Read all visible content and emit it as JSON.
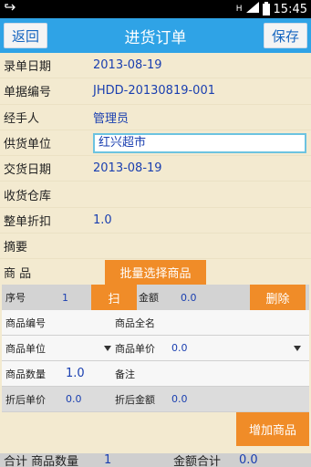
{
  "status_bar": {
    "time": "15:45",
    "left_icon": "usb-icon",
    "icons": [
      "sim-h-icon",
      "signal-icon",
      "battery-icon"
    ]
  },
  "header": {
    "back": "返回",
    "title": "进货订单",
    "save": "保存"
  },
  "form": [
    {
      "label": "录单日期",
      "value": "2013-08-19"
    },
    {
      "label": "单据编号",
      "value": "JHDD-20130819-001"
    },
    {
      "label": "经手人",
      "value": "管理员"
    },
    {
      "label": "供货单位",
      "value": "红兴超市"
    },
    {
      "label": "交货日期",
      "value": "2013-08-19"
    },
    {
      "label": "收货仓库",
      "value": ""
    },
    {
      "label": "整单折扣",
      "value": "1.0"
    },
    {
      "label": "摘要",
      "value": ""
    }
  ],
  "goods": {
    "label": "商 品",
    "batch_select": "批量选择商品"
  },
  "item": {
    "seq_label": "序号",
    "seq_value": "1",
    "scan": "扫",
    "amount_label": "金额",
    "amount_value": "0.0",
    "delete": "删除",
    "code_label": "商品编号",
    "fullname_label": "商品全名",
    "unit_label": "商品单位",
    "price_label": "商品单价",
    "price_value": "0.0",
    "qty_label": "商品数量",
    "qty_value": "1.0",
    "note_label": "备注",
    "disc_price_label": "折后单价",
    "disc_price_value": "0.0",
    "disc_amount_label": "折后金额",
    "disc_amount_value": "0.0"
  },
  "add_goods": "增加商品",
  "footer": {
    "total_label": "合计 商品数量",
    "qty": "1",
    "amount_label": "金额合计",
    "amount": "0.0"
  }
}
